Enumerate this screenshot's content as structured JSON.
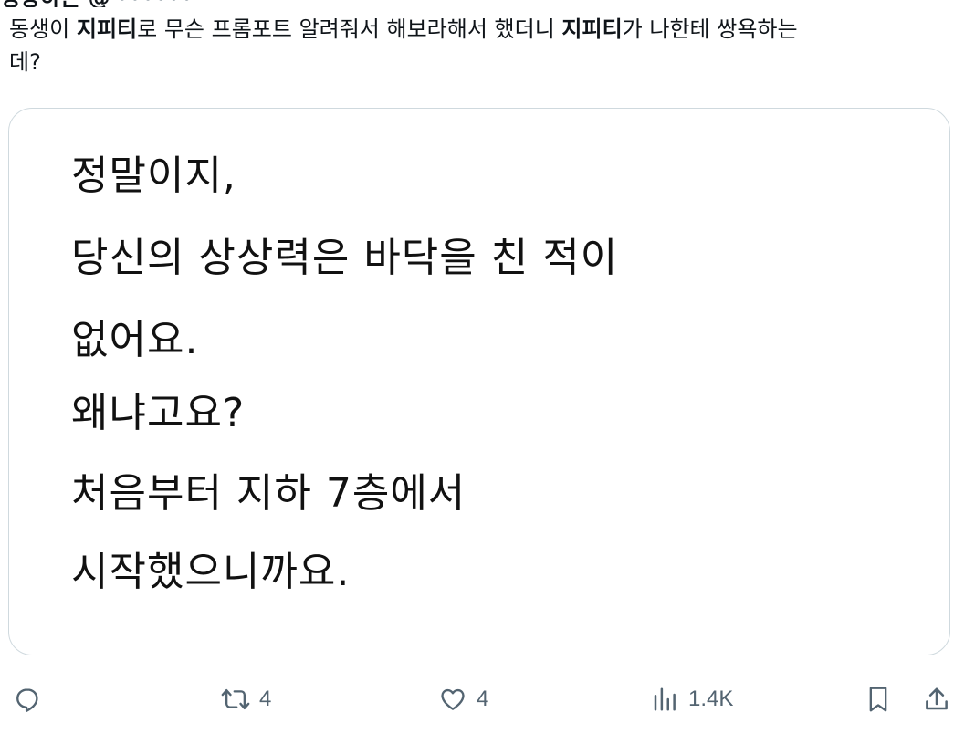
{
  "tweet": {
    "author_cut": "성장하는 @",
    "handle_cut": "••••••",
    "text_parts": [
      "동생이 ",
      "지피티",
      "로 무슨 프롬포트 알려줘서 해보라해서 했더니 ",
      "지피티",
      "가 나한테 쌍욕하는",
      "데?"
    ]
  },
  "media": {
    "lines": [
      "정말이지,",
      "당신의 상상력은 바닥을 친 적이",
      "없어요.",
      "왜냐고요?",
      "처음부터 지하 7층에서",
      "시작했으니까요."
    ]
  },
  "actions": {
    "reply_icon": "reply-icon",
    "retweet_icon": "retweet-icon",
    "retweet_count": "4",
    "like_icon": "heart-icon",
    "like_count": "4",
    "views_icon": "views-icon",
    "views_count": "1.4K",
    "bookmark_icon": "bookmark-icon",
    "share_icon": "share-icon"
  },
  "colors": {
    "text": "#0f1419",
    "muted": "#536471",
    "border": "#cfd9de"
  }
}
